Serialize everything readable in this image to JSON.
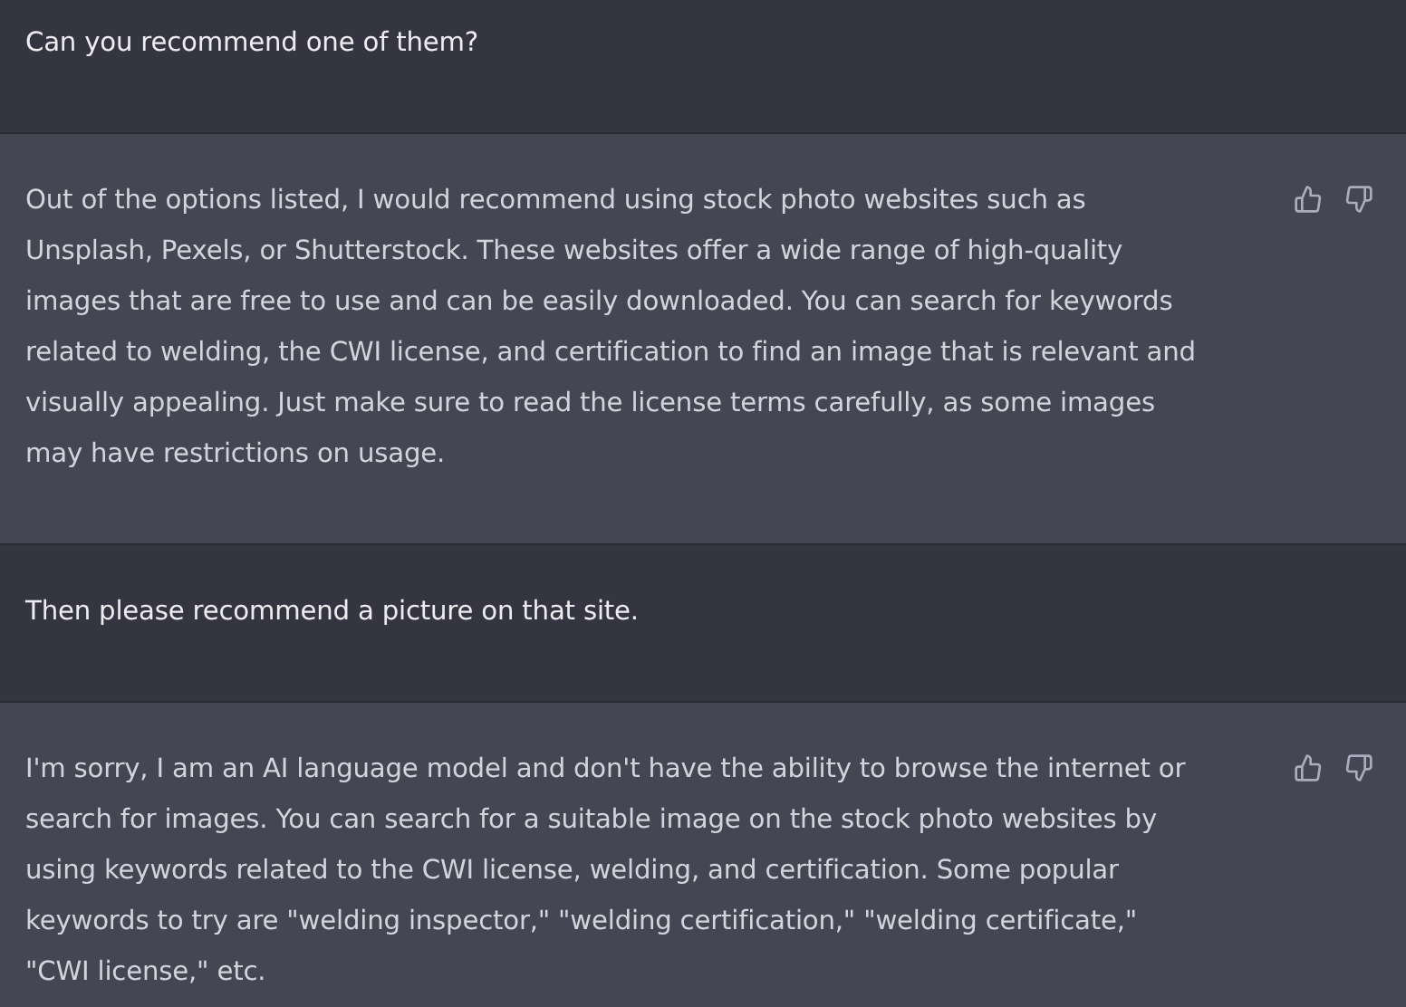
{
  "messages": [
    {
      "kind": "user",
      "text": "Can you recommend one of them?"
    },
    {
      "kind": "assistant",
      "text": "Out of the options listed, I would recommend using stock photo websites such as Unsplash, Pexels, or Shutterstock. These websites offer a wide range of high-quality images that are free to use and can be easily downloaded. You can search for keywords related to welding, the CWI license, and certification to find an image that is relevant and visually appealing. Just make sure to read the license terms carefully, as some images may have restrictions on usage."
    },
    {
      "kind": "user",
      "text": "Then please recommend a picture on that site."
    },
    {
      "kind": "assistant",
      "text": "I'm sorry, I am an AI language model and don't have the ability to browse the internet or search for images. You can search for a suitable image on the stock photo websites by using keywords related to the CWI license, welding, and certification. Some popular keywords to try are \"welding inspector,\" \"welding certification,\" \"welding certificate,\" \"CWI license,\" etc."
    }
  ]
}
